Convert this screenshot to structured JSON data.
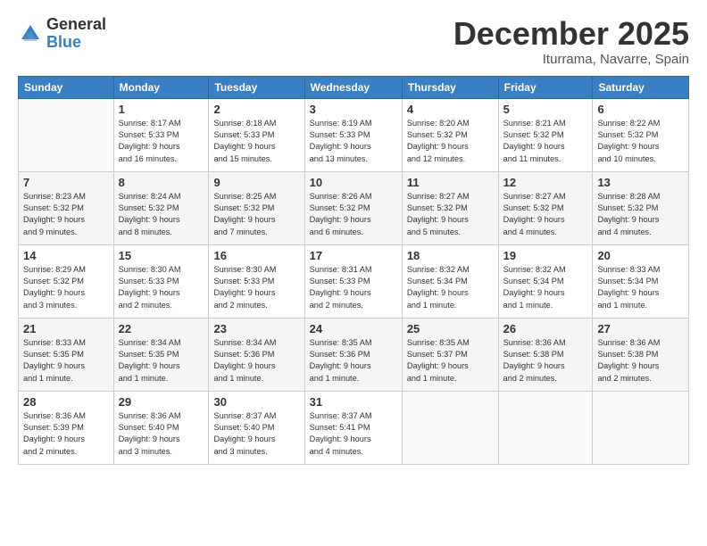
{
  "header": {
    "logo_general": "General",
    "logo_blue": "Blue",
    "month": "December 2025",
    "location": "Iturrama, Navarre, Spain"
  },
  "weekdays": [
    "Sunday",
    "Monday",
    "Tuesday",
    "Wednesday",
    "Thursday",
    "Friday",
    "Saturday"
  ],
  "weeks": [
    [
      {
        "day": "",
        "info": ""
      },
      {
        "day": "1",
        "info": "Sunrise: 8:17 AM\nSunset: 5:33 PM\nDaylight: 9 hours\nand 16 minutes."
      },
      {
        "day": "2",
        "info": "Sunrise: 8:18 AM\nSunset: 5:33 PM\nDaylight: 9 hours\nand 15 minutes."
      },
      {
        "day": "3",
        "info": "Sunrise: 8:19 AM\nSunset: 5:33 PM\nDaylight: 9 hours\nand 13 minutes."
      },
      {
        "day": "4",
        "info": "Sunrise: 8:20 AM\nSunset: 5:32 PM\nDaylight: 9 hours\nand 12 minutes."
      },
      {
        "day": "5",
        "info": "Sunrise: 8:21 AM\nSunset: 5:32 PM\nDaylight: 9 hours\nand 11 minutes."
      },
      {
        "day": "6",
        "info": "Sunrise: 8:22 AM\nSunset: 5:32 PM\nDaylight: 9 hours\nand 10 minutes."
      }
    ],
    [
      {
        "day": "7",
        "info": "Sunrise: 8:23 AM\nSunset: 5:32 PM\nDaylight: 9 hours\nand 9 minutes."
      },
      {
        "day": "8",
        "info": "Sunrise: 8:24 AM\nSunset: 5:32 PM\nDaylight: 9 hours\nand 8 minutes."
      },
      {
        "day": "9",
        "info": "Sunrise: 8:25 AM\nSunset: 5:32 PM\nDaylight: 9 hours\nand 7 minutes."
      },
      {
        "day": "10",
        "info": "Sunrise: 8:26 AM\nSunset: 5:32 PM\nDaylight: 9 hours\nand 6 minutes."
      },
      {
        "day": "11",
        "info": "Sunrise: 8:27 AM\nSunset: 5:32 PM\nDaylight: 9 hours\nand 5 minutes."
      },
      {
        "day": "12",
        "info": "Sunrise: 8:27 AM\nSunset: 5:32 PM\nDaylight: 9 hours\nand 4 minutes."
      },
      {
        "day": "13",
        "info": "Sunrise: 8:28 AM\nSunset: 5:32 PM\nDaylight: 9 hours\nand 4 minutes."
      }
    ],
    [
      {
        "day": "14",
        "info": "Sunrise: 8:29 AM\nSunset: 5:32 PM\nDaylight: 9 hours\nand 3 minutes."
      },
      {
        "day": "15",
        "info": "Sunrise: 8:30 AM\nSunset: 5:33 PM\nDaylight: 9 hours\nand 2 minutes."
      },
      {
        "day": "16",
        "info": "Sunrise: 8:30 AM\nSunset: 5:33 PM\nDaylight: 9 hours\nand 2 minutes."
      },
      {
        "day": "17",
        "info": "Sunrise: 8:31 AM\nSunset: 5:33 PM\nDaylight: 9 hours\nand 2 minutes."
      },
      {
        "day": "18",
        "info": "Sunrise: 8:32 AM\nSunset: 5:34 PM\nDaylight: 9 hours\nand 1 minute."
      },
      {
        "day": "19",
        "info": "Sunrise: 8:32 AM\nSunset: 5:34 PM\nDaylight: 9 hours\nand 1 minute."
      },
      {
        "day": "20",
        "info": "Sunrise: 8:33 AM\nSunset: 5:34 PM\nDaylight: 9 hours\nand 1 minute."
      }
    ],
    [
      {
        "day": "21",
        "info": "Sunrise: 8:33 AM\nSunset: 5:35 PM\nDaylight: 9 hours\nand 1 minute."
      },
      {
        "day": "22",
        "info": "Sunrise: 8:34 AM\nSunset: 5:35 PM\nDaylight: 9 hours\nand 1 minute."
      },
      {
        "day": "23",
        "info": "Sunrise: 8:34 AM\nSunset: 5:36 PM\nDaylight: 9 hours\nand 1 minute."
      },
      {
        "day": "24",
        "info": "Sunrise: 8:35 AM\nSunset: 5:36 PM\nDaylight: 9 hours\nand 1 minute."
      },
      {
        "day": "25",
        "info": "Sunrise: 8:35 AM\nSunset: 5:37 PM\nDaylight: 9 hours\nand 1 minute."
      },
      {
        "day": "26",
        "info": "Sunrise: 8:36 AM\nSunset: 5:38 PM\nDaylight: 9 hours\nand 2 minutes."
      },
      {
        "day": "27",
        "info": "Sunrise: 8:36 AM\nSunset: 5:38 PM\nDaylight: 9 hours\nand 2 minutes."
      }
    ],
    [
      {
        "day": "28",
        "info": "Sunrise: 8:36 AM\nSunset: 5:39 PM\nDaylight: 9 hours\nand 2 minutes."
      },
      {
        "day": "29",
        "info": "Sunrise: 8:36 AM\nSunset: 5:40 PM\nDaylight: 9 hours\nand 3 minutes."
      },
      {
        "day": "30",
        "info": "Sunrise: 8:37 AM\nSunset: 5:40 PM\nDaylight: 9 hours\nand 3 minutes."
      },
      {
        "day": "31",
        "info": "Sunrise: 8:37 AM\nSunset: 5:41 PM\nDaylight: 9 hours\nand 4 minutes."
      },
      {
        "day": "",
        "info": ""
      },
      {
        "day": "",
        "info": ""
      },
      {
        "day": "",
        "info": ""
      }
    ]
  ]
}
